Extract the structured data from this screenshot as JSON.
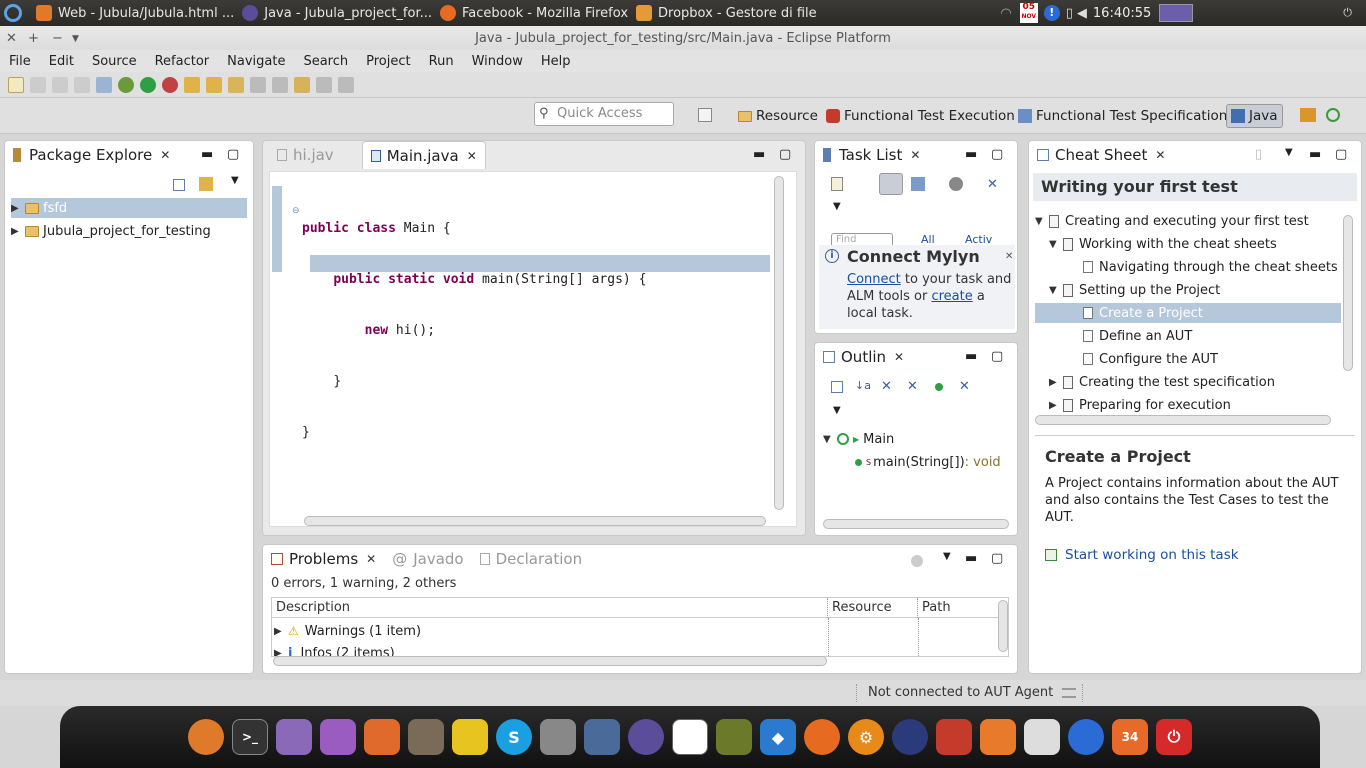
{
  "top_panel": {
    "tasks": [
      "Web - Jubula/Jubula.html ...",
      "Java - Jubula_project_for...",
      "Facebook - Mozilla Firefox",
      "Dropbox - Gestore di file"
    ],
    "date_day": "05",
    "date_month": "NOV",
    "clock": "16:40:55"
  },
  "window": {
    "title": "Java - Jubula_project_for_testing/src/Main.java - Eclipse Platform"
  },
  "menu": [
    "File",
    "Edit",
    "Source",
    "Refactor",
    "Navigate",
    "Search",
    "Project",
    "Run",
    "Window",
    "Help"
  ],
  "quick_access": {
    "placeholder": "Quick Access"
  },
  "perspectives": [
    "Resource",
    "Functional Test Execution",
    "Functional Test Specification",
    "Java"
  ],
  "package_explorer": {
    "title": "Package Explore",
    "items": [
      "fsfd",
      "Jubula_project_for_testing"
    ]
  },
  "editor": {
    "tabs": [
      "hi.jav",
      "Main.java"
    ],
    "lines": [
      {
        "kw": "public class",
        "rest": " Main {"
      },
      {
        "indent": "    ",
        "kw": "public static void",
        "rest": " main(String[] args) {"
      },
      {
        "indent": "        ",
        "kw": "new",
        "rest": " hi();"
      },
      {
        "indent": "    ",
        "rest": "}"
      },
      {
        "rest": "}"
      }
    ]
  },
  "task_list": {
    "title": "Task List",
    "find": "Find",
    "all": "All",
    "activ": "Activ",
    "connect_title": "Connect Mylyn",
    "connect_link": "Connect",
    "text1": " to your task and ALM tools or ",
    "create_link": "create",
    "text2": " a local task."
  },
  "outline": {
    "title": "Outlin",
    "class_name": "Main",
    "method_sup": "S",
    "method": "main(String[])",
    "method_type": " : void"
  },
  "cheat_sheet": {
    "tab_title": "Cheat Sheet",
    "heading": "Writing your first test",
    "items": [
      "Creating and executing your first test",
      "Working with the cheat sheets",
      "Navigating through the cheat sheets",
      "Setting up the Project",
      "Create a Project",
      "Define an AUT",
      "Configure the AUT",
      "Creating the test specification",
      "Preparing for execution"
    ],
    "detail_title": "Create a Project",
    "detail_text": "A Project contains information about the AUT and also contains the Test Cases to test the AUT.",
    "start_link": "Start working on this task"
  },
  "problems": {
    "tabs": [
      "Problems",
      "Javado",
      "Declaration"
    ],
    "summary": "0 errors, 1 warning, 2 others",
    "columns": [
      "Description",
      "Resource",
      "Path"
    ],
    "rows": [
      "Warnings (1 item)",
      "Infos (2 items)"
    ]
  },
  "status": {
    "text": "Not connected to AUT Agent"
  },
  "dock": {
    "badge": "34"
  },
  "colors": {
    "selection": "#b5c7da",
    "link": "#1a4fa0",
    "keyword": "#7f0055"
  }
}
